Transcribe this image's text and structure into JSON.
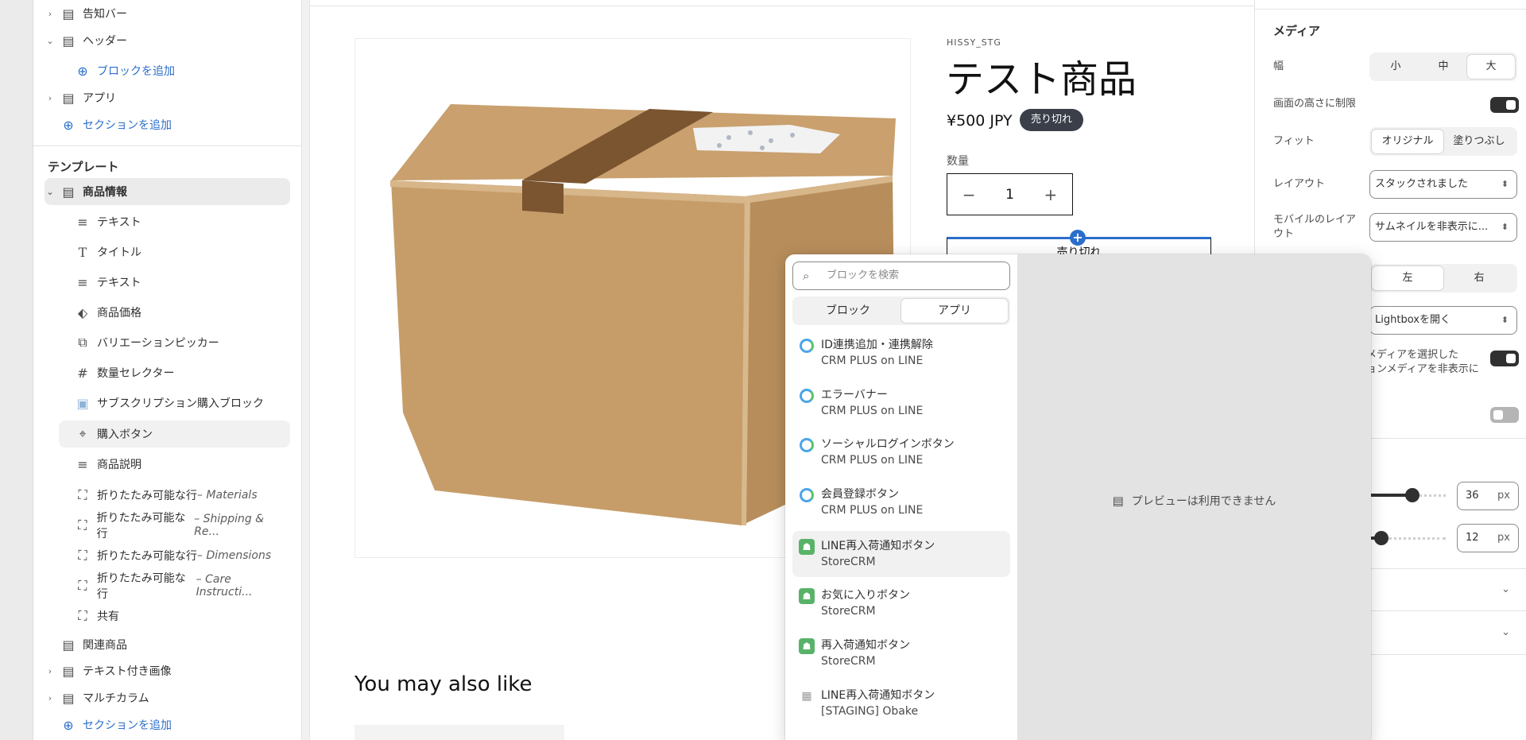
{
  "sidebar": {
    "rows": [
      {
        "label": "告知バー",
        "icon": "section-icon",
        "chevron": "›"
      },
      {
        "label": "ヘッダー",
        "icon": "header-section-icon",
        "chevron": "⌄"
      },
      {
        "label": "アプリ",
        "icon": "section-icon",
        "chevron": "›"
      }
    ],
    "add_block": "ブロックを追加",
    "add_section": "セクションを追加",
    "template_heading": "テンプレート",
    "product_info": "商品情報",
    "blocks": [
      {
        "label": "テキスト",
        "icon": "text-lines-icon"
      },
      {
        "label": "タイトル",
        "icon": "title-t-icon"
      },
      {
        "label": "テキスト",
        "icon": "text-lines-icon"
      },
      {
        "label": "商品価格",
        "icon": "price-tag-icon"
      },
      {
        "label": "バリエーションピッカー",
        "icon": "variant-picker-icon"
      },
      {
        "label": "数量セレクター",
        "icon": "hash-icon"
      },
      {
        "label": "サブスクリプション購入ブロック",
        "icon": "app-image-icon"
      },
      {
        "label": "購入ボタン",
        "icon": "buy-button-icon"
      },
      {
        "label": "商品説明",
        "icon": "text-lines-icon"
      }
    ],
    "collapsibles": [
      {
        "label": "折りたたみ可能な行",
        "suffix": " – Materials"
      },
      {
        "label": "折りたたみ可能な行",
        "suffix": " – Shipping & Re..."
      },
      {
        "label": "折りたたみ可能な行",
        "suffix": " – Dimensions"
      },
      {
        "label": "折りたたみ可能な行",
        "suffix": " – Care Instructi..."
      }
    ],
    "share": "共有",
    "related": "関連商品",
    "image_with_text": "テキスト付き画像",
    "multicolumn": "マルチカラム",
    "add_section_bottom": "セクションを追加"
  },
  "product": {
    "vendor": "HISSY_STG",
    "title": "テスト商品",
    "price": "¥500 JPY",
    "badge": "売り切れ",
    "qty_label": "数量",
    "qty_minus": "−",
    "qty_value": "1",
    "qty_plus": "+",
    "add_cart_label": "売り切れ",
    "insert_plus": "+",
    "also_like": "You may also like"
  },
  "settings": {
    "title": "メディア",
    "width_label": "幅",
    "width_options": [
      "小",
      "中",
      "大"
    ],
    "width_selected": "大",
    "limit_height_label": "画面の高さに制限",
    "limit_height_on": true,
    "fit_label": "フィット",
    "fit_options": [
      "オリジナル",
      "塗りつぶし"
    ],
    "fit_selected": "オリジナル",
    "layout_label": "レイアウト",
    "layout_value": "スタックされました",
    "mobile_layout_label": "モバイルのレイアウト",
    "mobile_layout_value": "サムネイルを非表示に...",
    "position_options": [
      "左",
      "右"
    ],
    "position_selected": "左",
    "zoom_value": "Lightboxを開く",
    "hide_media_text": "メディアを選択した\nョンメディアを非表示に",
    "hide_media_on": true,
    "loop_on": false,
    "padding_top": {
      "value": "36",
      "unit": "px",
      "fraction": 0.2
    },
    "padding_bottom": {
      "value": "12",
      "unit": "px",
      "fraction": 0.07
    }
  },
  "picker": {
    "search_placeholder": "ブロックを検索",
    "tabs": [
      "ブロック",
      "アプリ"
    ],
    "active_tab": "アプリ",
    "items": [
      {
        "name": "ID連携追加・連携解除",
        "app": "CRM PLUS on LINE",
        "icon": "crm-plus-icon"
      },
      {
        "name": "エラーバナー",
        "app": "CRM PLUS on LINE",
        "icon": "crm-plus-icon"
      },
      {
        "name": "ソーシャルログインボタン",
        "app": "CRM PLUS on LINE",
        "icon": "crm-plus-icon"
      },
      {
        "name": "会員登録ボタン",
        "app": "CRM PLUS on LINE",
        "icon": "crm-plus-icon"
      },
      {
        "name": "LINE再入荷通知ボタン",
        "app": "StoreCRM",
        "icon": "storecrm-icon"
      },
      {
        "name": "お気に入りボタン",
        "app": "StoreCRM",
        "icon": "storecrm-icon"
      },
      {
        "name": "再入荷通知ボタン",
        "app": "StoreCRM",
        "icon": "storecrm-icon"
      },
      {
        "name": "LINE再入荷通知ボタン",
        "app": "[STAGING] Obake",
        "icon": "app-grid-icon"
      }
    ],
    "highlighted_index": 4,
    "preview_unavailable": "プレビューは利用できません"
  }
}
